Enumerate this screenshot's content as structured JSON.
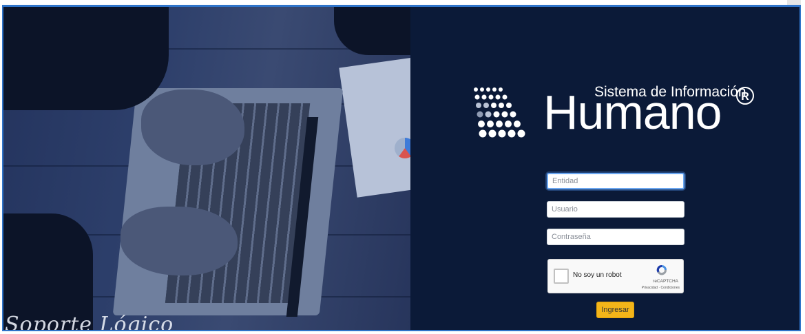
{
  "brand": {
    "subtitle": "Sistema de Información",
    "name": "Humano",
    "registered": "R"
  },
  "login": {
    "entidad_placeholder": "Entidad",
    "usuario_placeholder": "Usuario",
    "password_placeholder": "Contraseña",
    "submit_label": "Ingresar"
  },
  "captcha": {
    "label": "No soy un robot",
    "brand": "reCAPTCHA",
    "terms": "Privacidad · Condiciones"
  },
  "background": {
    "watermark": "Soporte Lógico"
  },
  "colors": {
    "panel_bg": "#0b1a38",
    "accent_button": "#f4b519",
    "frame_border": "#2f74c9",
    "focus_ring": "#6aa6f0"
  }
}
